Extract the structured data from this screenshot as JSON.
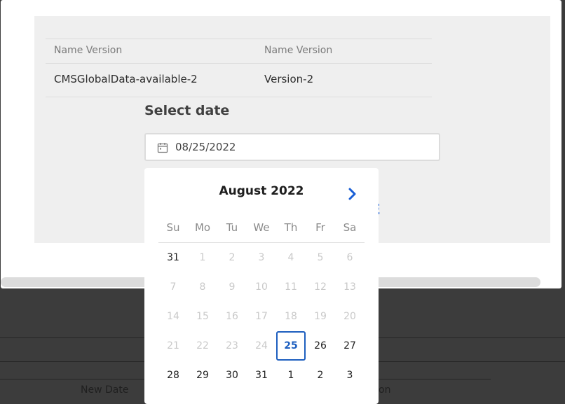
{
  "background": {
    "new_date_label": "New Date",
    "partial_label": "on"
  },
  "modal": {
    "close_icon": "close-icon",
    "table": {
      "headers": [
        "Name Version",
        "Name Version"
      ],
      "row": [
        "CMSGlobalData-available-2",
        "Version-2"
      ]
    },
    "select_date_title": "Select date",
    "date_input_value": "08/25/2022",
    "calendar_icon": "calendar-icon",
    "partial_button_text": "E"
  },
  "datepicker": {
    "month_label": "August 2022",
    "next_icon": "chevron-right-icon",
    "weekdays": [
      "Su",
      "Mo",
      "Tu",
      "We",
      "Th",
      "Fr",
      "Sa"
    ],
    "weeks": [
      [
        {
          "d": "31",
          "s": "enabled"
        },
        {
          "d": "1",
          "s": "disabled"
        },
        {
          "d": "2",
          "s": "disabled"
        },
        {
          "d": "3",
          "s": "disabled"
        },
        {
          "d": "4",
          "s": "disabled"
        },
        {
          "d": "5",
          "s": "disabled"
        },
        {
          "d": "6",
          "s": "disabled"
        }
      ],
      [
        {
          "d": "7",
          "s": "disabled"
        },
        {
          "d": "8",
          "s": "disabled"
        },
        {
          "d": "9",
          "s": "disabled"
        },
        {
          "d": "10",
          "s": "disabled"
        },
        {
          "d": "11",
          "s": "disabled"
        },
        {
          "d": "12",
          "s": "disabled"
        },
        {
          "d": "13",
          "s": "disabled"
        }
      ],
      [
        {
          "d": "14",
          "s": "disabled"
        },
        {
          "d": "15",
          "s": "disabled"
        },
        {
          "d": "16",
          "s": "disabled"
        },
        {
          "d": "17",
          "s": "disabled"
        },
        {
          "d": "18",
          "s": "disabled"
        },
        {
          "d": "19",
          "s": "disabled"
        },
        {
          "d": "20",
          "s": "disabled"
        }
      ],
      [
        {
          "d": "21",
          "s": "disabled"
        },
        {
          "d": "22",
          "s": "disabled"
        },
        {
          "d": "23",
          "s": "disabled"
        },
        {
          "d": "24",
          "s": "disabled"
        },
        {
          "d": "25",
          "s": "selected"
        },
        {
          "d": "26",
          "s": "enabled"
        },
        {
          "d": "27",
          "s": "enabled"
        }
      ],
      [
        {
          "d": "28",
          "s": "enabled"
        },
        {
          "d": "29",
          "s": "enabled"
        },
        {
          "d": "30",
          "s": "enabled"
        },
        {
          "d": "31",
          "s": "enabled"
        },
        {
          "d": "1",
          "s": "enabled"
        },
        {
          "d": "2",
          "s": "enabled"
        },
        {
          "d": "3",
          "s": "enabled"
        }
      ]
    ],
    "colors": {
      "selected": "#1e5fbf",
      "disabled": "#c9c9c9",
      "enabled": "#222222"
    }
  }
}
